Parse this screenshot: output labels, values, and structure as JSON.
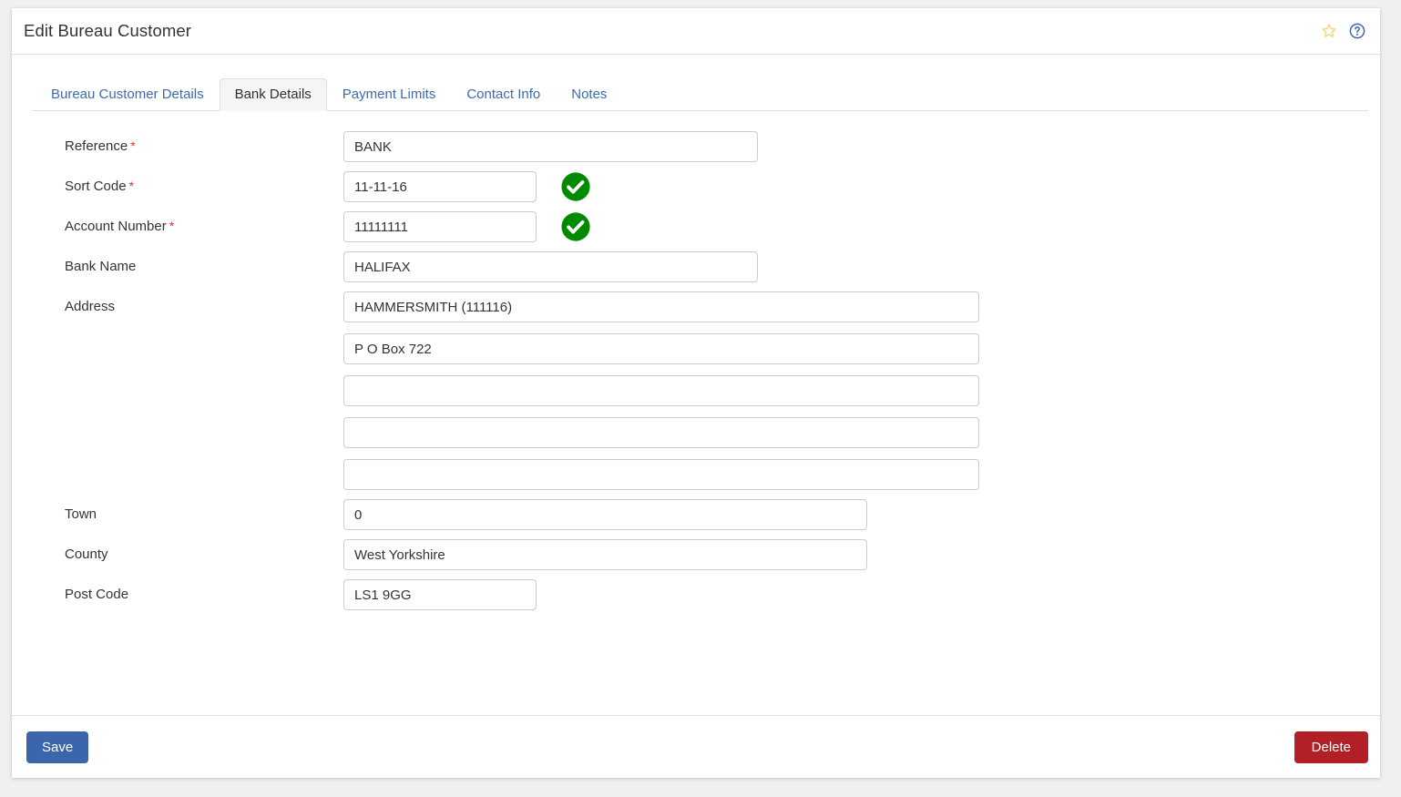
{
  "header": {
    "title": "Edit Bureau Customer",
    "favorite_icon": "star-icon",
    "help_icon": "help-circle-icon"
  },
  "tabs": [
    {
      "label": "Bureau Customer Details",
      "active": false
    },
    {
      "label": "Bank Details",
      "active": true
    },
    {
      "label": "Payment Limits",
      "active": false
    },
    {
      "label": "Contact Info",
      "active": false
    },
    {
      "label": "Notes",
      "active": false
    }
  ],
  "form": {
    "reference": {
      "label": "Reference",
      "required": true,
      "value": "BANK",
      "placeholder": ""
    },
    "sort_code": {
      "label": "Sort Code",
      "required": true,
      "value": "11-11-16",
      "placeholder": "",
      "status_icon": "valid-check-icon"
    },
    "account_number": {
      "label": "Account Number",
      "required": true,
      "value": "11111111",
      "placeholder": "",
      "status_icon": "valid-check-icon"
    },
    "bank_name": {
      "label": "Bank Name",
      "required": false,
      "value": "HALIFAX",
      "placeholder": ""
    },
    "address": {
      "label": "Address",
      "required": false,
      "lines": [
        {
          "value": "HAMMERSMITH (111116)",
          "placeholder": ""
        },
        {
          "value": "P O Box 722",
          "placeholder": ""
        },
        {
          "value": "",
          "placeholder": ""
        },
        {
          "value": "",
          "placeholder": ""
        },
        {
          "value": "",
          "placeholder": ""
        }
      ]
    },
    "town": {
      "label": "Town",
      "required": false,
      "value": "0",
      "placeholder": ""
    },
    "county": {
      "label": "County",
      "required": false,
      "value": "West Yorkshire",
      "placeholder": ""
    },
    "post_code": {
      "label": "Post Code",
      "required": false,
      "value": "LS1 9GG",
      "placeholder": ""
    }
  },
  "footer": {
    "save_label": "Save",
    "delete_label": "Delete"
  },
  "colors": {
    "save_button": "#3c66ab",
    "delete_button": "#b21f27",
    "required_asterisk": "#d9322e",
    "tab_link": "#3c6bb0",
    "valid_check": "#008a00",
    "favorite_star": "#f5df8c",
    "help_icon": "#3c66ab"
  }
}
